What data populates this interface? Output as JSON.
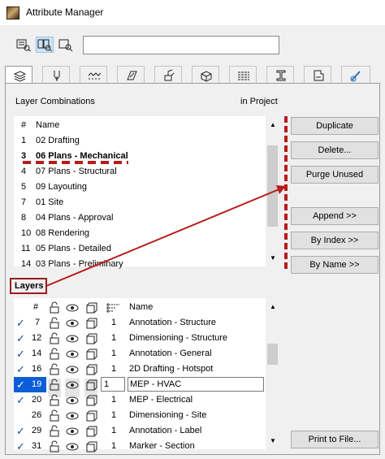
{
  "window": {
    "title": "Attribute Manager"
  },
  "toolbar": {
    "view_buttons": [
      "list-view-icon",
      "list-view-active-icon",
      "search-view-icon"
    ],
    "search": {
      "value": "",
      "placeholder": ""
    }
  },
  "tabs": [
    "layers-icon",
    "pen-icon",
    "line-type-icon",
    "fill-icon",
    "surface-icon",
    "building-material-icon",
    "composite-icon",
    "profile-icon",
    "zone-icon",
    "render-icon"
  ],
  "combinations": {
    "section_label": "Layer Combinations",
    "location_label": "in Project",
    "columns": {
      "num": "#",
      "name": "Name"
    },
    "rows": [
      {
        "num": "1",
        "name": "02 Drafting",
        "bold": false
      },
      {
        "num": "3",
        "name": "06 Plans - Mechanical",
        "bold": true
      },
      {
        "num": "4",
        "name": "07 Plans - Structural",
        "bold": false
      },
      {
        "num": "5",
        "name": "09 Layouting",
        "bold": false
      },
      {
        "num": "7",
        "name": "01 Site",
        "bold": false
      },
      {
        "num": "8",
        "name": "04 Plans - Approval",
        "bold": false
      },
      {
        "num": "10",
        "name": "08 Rendering",
        "bold": false
      },
      {
        "num": "11",
        "name": "05 Plans - Detailed",
        "bold": false
      },
      {
        "num": "14",
        "name": "03 Plans - Preliminary",
        "bold": false
      }
    ]
  },
  "buttons": {
    "duplicate": "Duplicate",
    "delete": "Delete...",
    "purge": "Purge Unused",
    "append": "Append >>",
    "by_index": "By Index >>",
    "by_name": "By Name >>",
    "print": "Print to File..."
  },
  "layers": {
    "section_label": "Layers",
    "columns": {
      "num": "#",
      "name": "Name"
    },
    "rows": [
      {
        "checked": true,
        "num": "7",
        "pen": "1",
        "name": "Annotation - Structure",
        "selected": false
      },
      {
        "checked": true,
        "num": "12",
        "pen": "1",
        "name": "Dimensioning - Structure",
        "selected": false
      },
      {
        "checked": true,
        "num": "14",
        "pen": "1",
        "name": "Annotation - General",
        "selected": false
      },
      {
        "checked": true,
        "num": "16",
        "pen": "1",
        "name": "2D Drafting - Hotspot",
        "selected": false
      },
      {
        "checked": true,
        "num": "19",
        "pen": "1",
        "name": "MEP - HVAC",
        "selected": true
      },
      {
        "checked": true,
        "num": "20",
        "pen": "1",
        "name": "MEP - Electrical",
        "selected": false
      },
      {
        "checked": false,
        "num": "26",
        "pen": "1",
        "name": "Dimensioning - Site",
        "selected": false
      },
      {
        "checked": true,
        "num": "29",
        "pen": "1",
        "name": "Annotation - Label",
        "selected": false
      },
      {
        "checked": true,
        "num": "31",
        "pen": "1",
        "name": "Marker - Section",
        "selected": false
      }
    ]
  },
  "colors": {
    "annotation": "#b81c1c",
    "selection": "#0b5ed7"
  }
}
